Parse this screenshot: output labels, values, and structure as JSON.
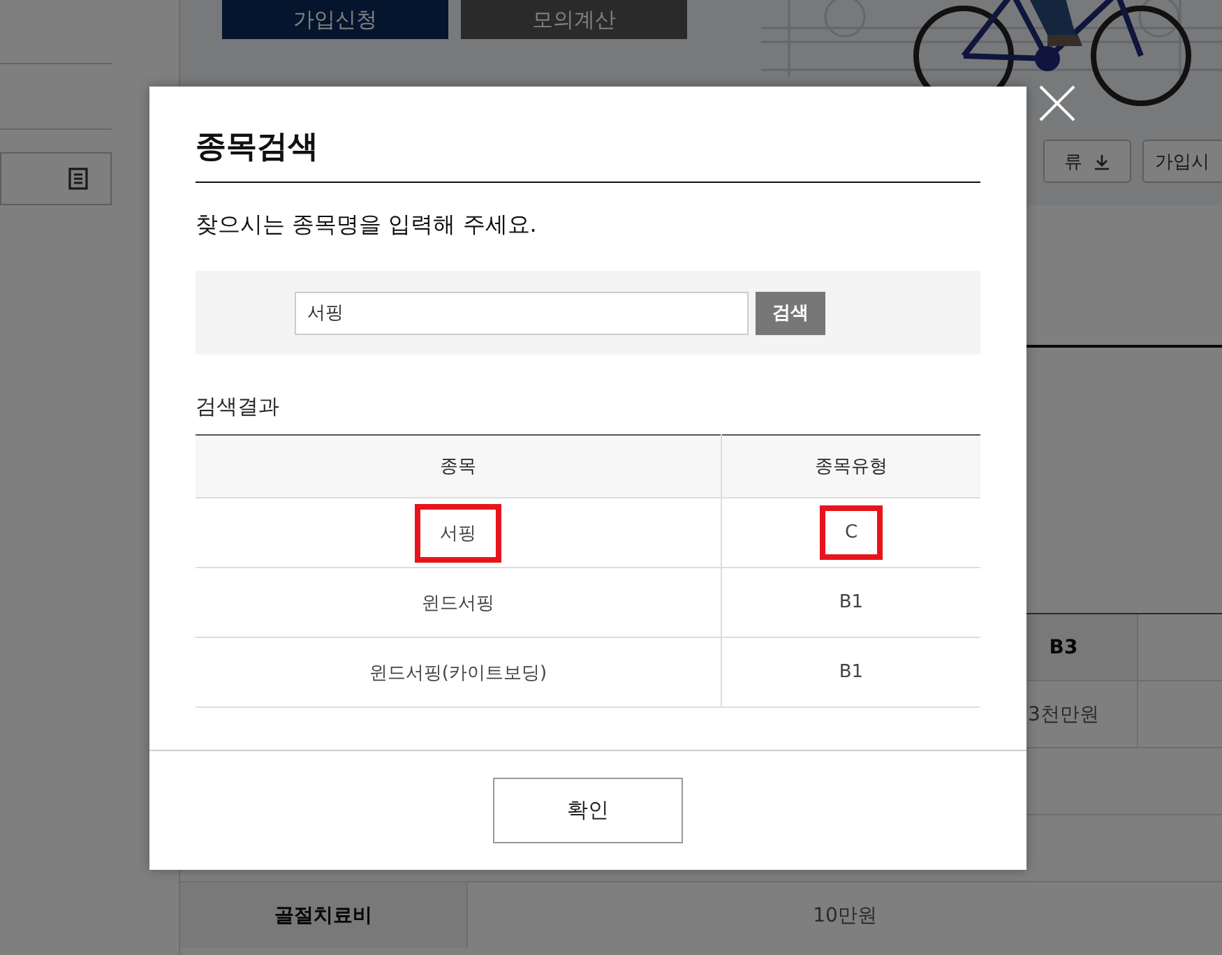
{
  "background": {
    "banner_buttons": [
      {
        "label": "가입신청",
        "kind": "primary"
      },
      {
        "label": "모의계산",
        "kind": "secondary"
      }
    ],
    "tool_buttons": [
      "류",
      "가입시"
    ],
    "table": {
      "header": "B3",
      "amount": "3천만원",
      "row_label": "골절치료비",
      "row_value": "10만원"
    }
  },
  "dialog": {
    "title": "종목검색",
    "instruction": "찾으시는 종목명을 입력해 주세요.",
    "search": {
      "value": "서핑",
      "button": "검색"
    },
    "results_title": "검색결과",
    "columns": [
      "종목",
      "종목유형"
    ],
    "rows": [
      {
        "name": "서핑",
        "type": "C",
        "highlighted": true
      },
      {
        "name": "윈드서핑",
        "type": "B1",
        "highlighted": false
      },
      {
        "name": "윈드서핑(카이트보딩)",
        "type": "B1",
        "highlighted": false
      }
    ],
    "confirm": "확인"
  }
}
